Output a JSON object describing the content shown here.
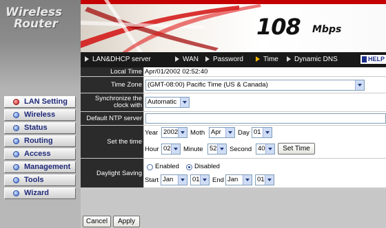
{
  "brand": {
    "line1": "Wireless",
    "line2": "Router"
  },
  "header": {
    "speed_number": "108",
    "speed_unit": "Mbps"
  },
  "menu": {
    "items": [
      {
        "label": "LAN&DHCP server"
      },
      {
        "label": "WAN"
      },
      {
        "label": "Password"
      },
      {
        "label": "Time"
      },
      {
        "label": "Dynamic DNS"
      }
    ],
    "current": "Time",
    "help_label": "HELP"
  },
  "sidebar": {
    "items": [
      {
        "label": "LAN Setting"
      },
      {
        "label": "Wireless"
      },
      {
        "label": "Status"
      },
      {
        "label": "Routing"
      },
      {
        "label": "Access"
      },
      {
        "label": "Management"
      },
      {
        "label": "Tools"
      },
      {
        "label": "Wizard"
      }
    ],
    "active": "LAN Setting"
  },
  "form": {
    "local_time": {
      "label": "Local Time",
      "value": "Apr/01/2002 02:52:40"
    },
    "time_zone": {
      "label": "Time Zone",
      "value": "(GMT-08:00) Pacific Time (US & Canada)"
    },
    "sync": {
      "label_line1": "Synchronize the",
      "label_line2": "clock with",
      "value": "Automatic"
    },
    "ntp": {
      "label": "Default NTP server",
      "value": ""
    },
    "set_time": {
      "label": "Set the time",
      "year_label": "Year",
      "year": "2002",
      "month_label": "Moth",
      "month": "Apr",
      "day_label": "Day",
      "day": "01",
      "hour_label": "Hour",
      "hour": "02",
      "minute_label": "Minute",
      "minute": "52",
      "second_label": "Second",
      "second": "40",
      "button": "Set Time"
    },
    "daylight": {
      "label": "Daylight Saving",
      "enabled_label": "Enabled",
      "disabled_label": "Disabled",
      "selected": "Disabled",
      "start_label": "Start",
      "start_month": "Jan",
      "start_day": "01",
      "end_label": "End",
      "end_month": "Jan",
      "end_day": "01"
    }
  },
  "actions": {
    "cancel": "Cancel",
    "apply": "Apply"
  },
  "colors": {
    "menu_bar": "#191919",
    "label_bg": "#2b2b2b",
    "nav_text": "#1e2a78",
    "active_bullet": "#c81414",
    "current_arrow": "#f4b400"
  }
}
